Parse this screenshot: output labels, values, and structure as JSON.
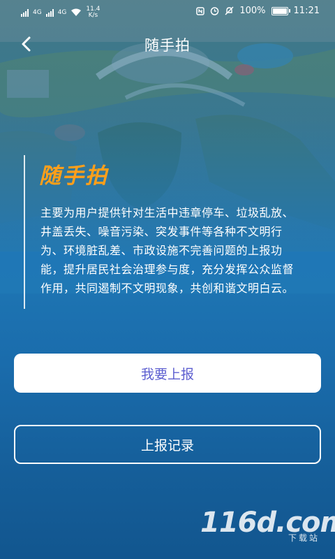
{
  "status_bar": {
    "network1": "4G",
    "network2": "4G",
    "speed_value": "11.4",
    "speed_unit": "K/s",
    "battery": "100%",
    "time": "11:21"
  },
  "header": {
    "title": "随手拍"
  },
  "feature": {
    "title": "随手拍",
    "description": "主要为用户提供针对生活中违章停车、垃圾乱放、井盖丢失、噪音污染、突发事件等各种不文明行为、环境脏乱差、市政设施不完善问题的上报功能，提升居民社会治理参与度，充分发挥公众监督作用，共同遏制不文明现象，共创和谐文明白云。"
  },
  "actions": {
    "report_label": "我要上报",
    "records_label": "上报记录"
  },
  "watermark": {
    "main": "116d.com",
    "sub": "下载站"
  },
  "colors": {
    "accent_orange": "#ff9f1a",
    "primary_button_text": "#5d5fd0",
    "background_blue": "#1f78b5"
  }
}
